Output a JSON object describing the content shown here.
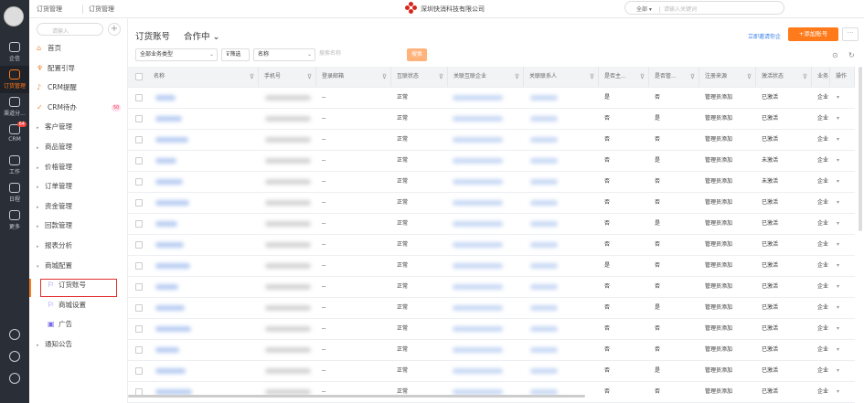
{
  "rail": {
    "items": [
      {
        "label": "企信"
      },
      {
        "label": "订货管理",
        "active": true
      },
      {
        "label": "渠道分..."
      },
      {
        "label": "CRM",
        "badge": "64"
      },
      {
        "label": "工作"
      },
      {
        "label": "日程"
      },
      {
        "label": "更多"
      }
    ]
  },
  "header": {
    "crumb1": "订货管理",
    "crumb2": "订货管理",
    "company": "深圳快消科技有限公司",
    "search_scope": "全部",
    "search_placeholder": "请输入关键词"
  },
  "sidebar": {
    "search_placeholder": "请输入",
    "items": [
      {
        "label": "首页",
        "icon": "home-icon",
        "mk": "⌂"
      },
      {
        "label": "配置引导",
        "icon": "guide-icon",
        "mk": "♆"
      },
      {
        "label": "CRM提醒",
        "icon": "bell-icon",
        "mk": "♪"
      },
      {
        "label": "CRM待办",
        "icon": "check-icon",
        "mk": "✓",
        "badge": "50"
      },
      {
        "label": "客户管理",
        "mk": "▸"
      },
      {
        "label": "商品管理",
        "mk": "▸"
      },
      {
        "label": "价格管理",
        "mk": "▸"
      },
      {
        "label": "订单管理",
        "mk": "▸"
      },
      {
        "label": "资金管理",
        "mk": "▸"
      },
      {
        "label": "回款管理",
        "mk": "▸"
      },
      {
        "label": "报表分析",
        "mk": "▸"
      },
      {
        "label": "商城配置",
        "mk": "▾"
      },
      {
        "label": "订货账号",
        "mk": "⚐",
        "sub": true,
        "selected": true
      },
      {
        "label": "商城设置",
        "mk": "⚐",
        "sub": true
      },
      {
        "label": "广告",
        "mk": "▣",
        "sub": true
      },
      {
        "label": "通知公告",
        "mk": "▸"
      }
    ]
  },
  "main": {
    "title": "订货账号",
    "status": "合作中",
    "invite_link": "立即邀请你企",
    "add_button": "+添加账号",
    "more": "···",
    "filter": {
      "type": "全部业务类型",
      "filter_btn": "筛选",
      "field": "名称",
      "search_placeholder": "搜索名称",
      "search_btn": "搜索"
    },
    "columns": [
      "名称",
      "手机号",
      "登录邮箱",
      "互联状态",
      "关联互联企业",
      "关联联系人",
      "是否主...",
      "是否管...",
      "注册来源",
      "激活状态",
      "业务",
      "操作"
    ],
    "rows": [
      [
        "--",
        "正常",
        "是",
        "否",
        "管理员添加",
        "已激活",
        "企业"
      ],
      [
        "--",
        "正常",
        "否",
        "是",
        "管理员添加",
        "已激活",
        "企业"
      ],
      [
        "--",
        "正常",
        "否",
        "否",
        "管理员添加",
        "已激活",
        "企业"
      ],
      [
        "--",
        "正常",
        "否",
        "是",
        "管理员添加",
        "未激活",
        "企业"
      ],
      [
        "--",
        "正常",
        "否",
        "否",
        "管理员添加",
        "未激活",
        "企业"
      ],
      [
        "--",
        "正常",
        "否",
        "否",
        "管理员添加",
        "已激活",
        "企业"
      ],
      [
        "--",
        "正常",
        "否",
        "是",
        "管理员添加",
        "已激活",
        "企业"
      ],
      [
        "--",
        "正常",
        "否",
        "否",
        "管理员添加",
        "已激活",
        "企业"
      ],
      [
        "--",
        "正常",
        "是",
        "否",
        "管理员添加",
        "已激活",
        "企业"
      ],
      [
        "--",
        "正常",
        "否",
        "否",
        "管理员添加",
        "已激活",
        "企业"
      ],
      [
        "--",
        "正常",
        "否",
        "是",
        "管理员添加",
        "已激活",
        "企业"
      ],
      [
        "--",
        "正常",
        "否",
        "否",
        "管理员添加",
        "已激活",
        "企业"
      ],
      [
        "--",
        "正常",
        "否",
        "否",
        "管理员添加",
        "已激活",
        "企业"
      ],
      [
        "--",
        "正常",
        "否",
        "是",
        "管理员添加",
        "已激活",
        "企业"
      ],
      [
        "--",
        "正常",
        "否",
        "否",
        "管理员添加",
        "已激活",
        "企业"
      ]
    ]
  }
}
